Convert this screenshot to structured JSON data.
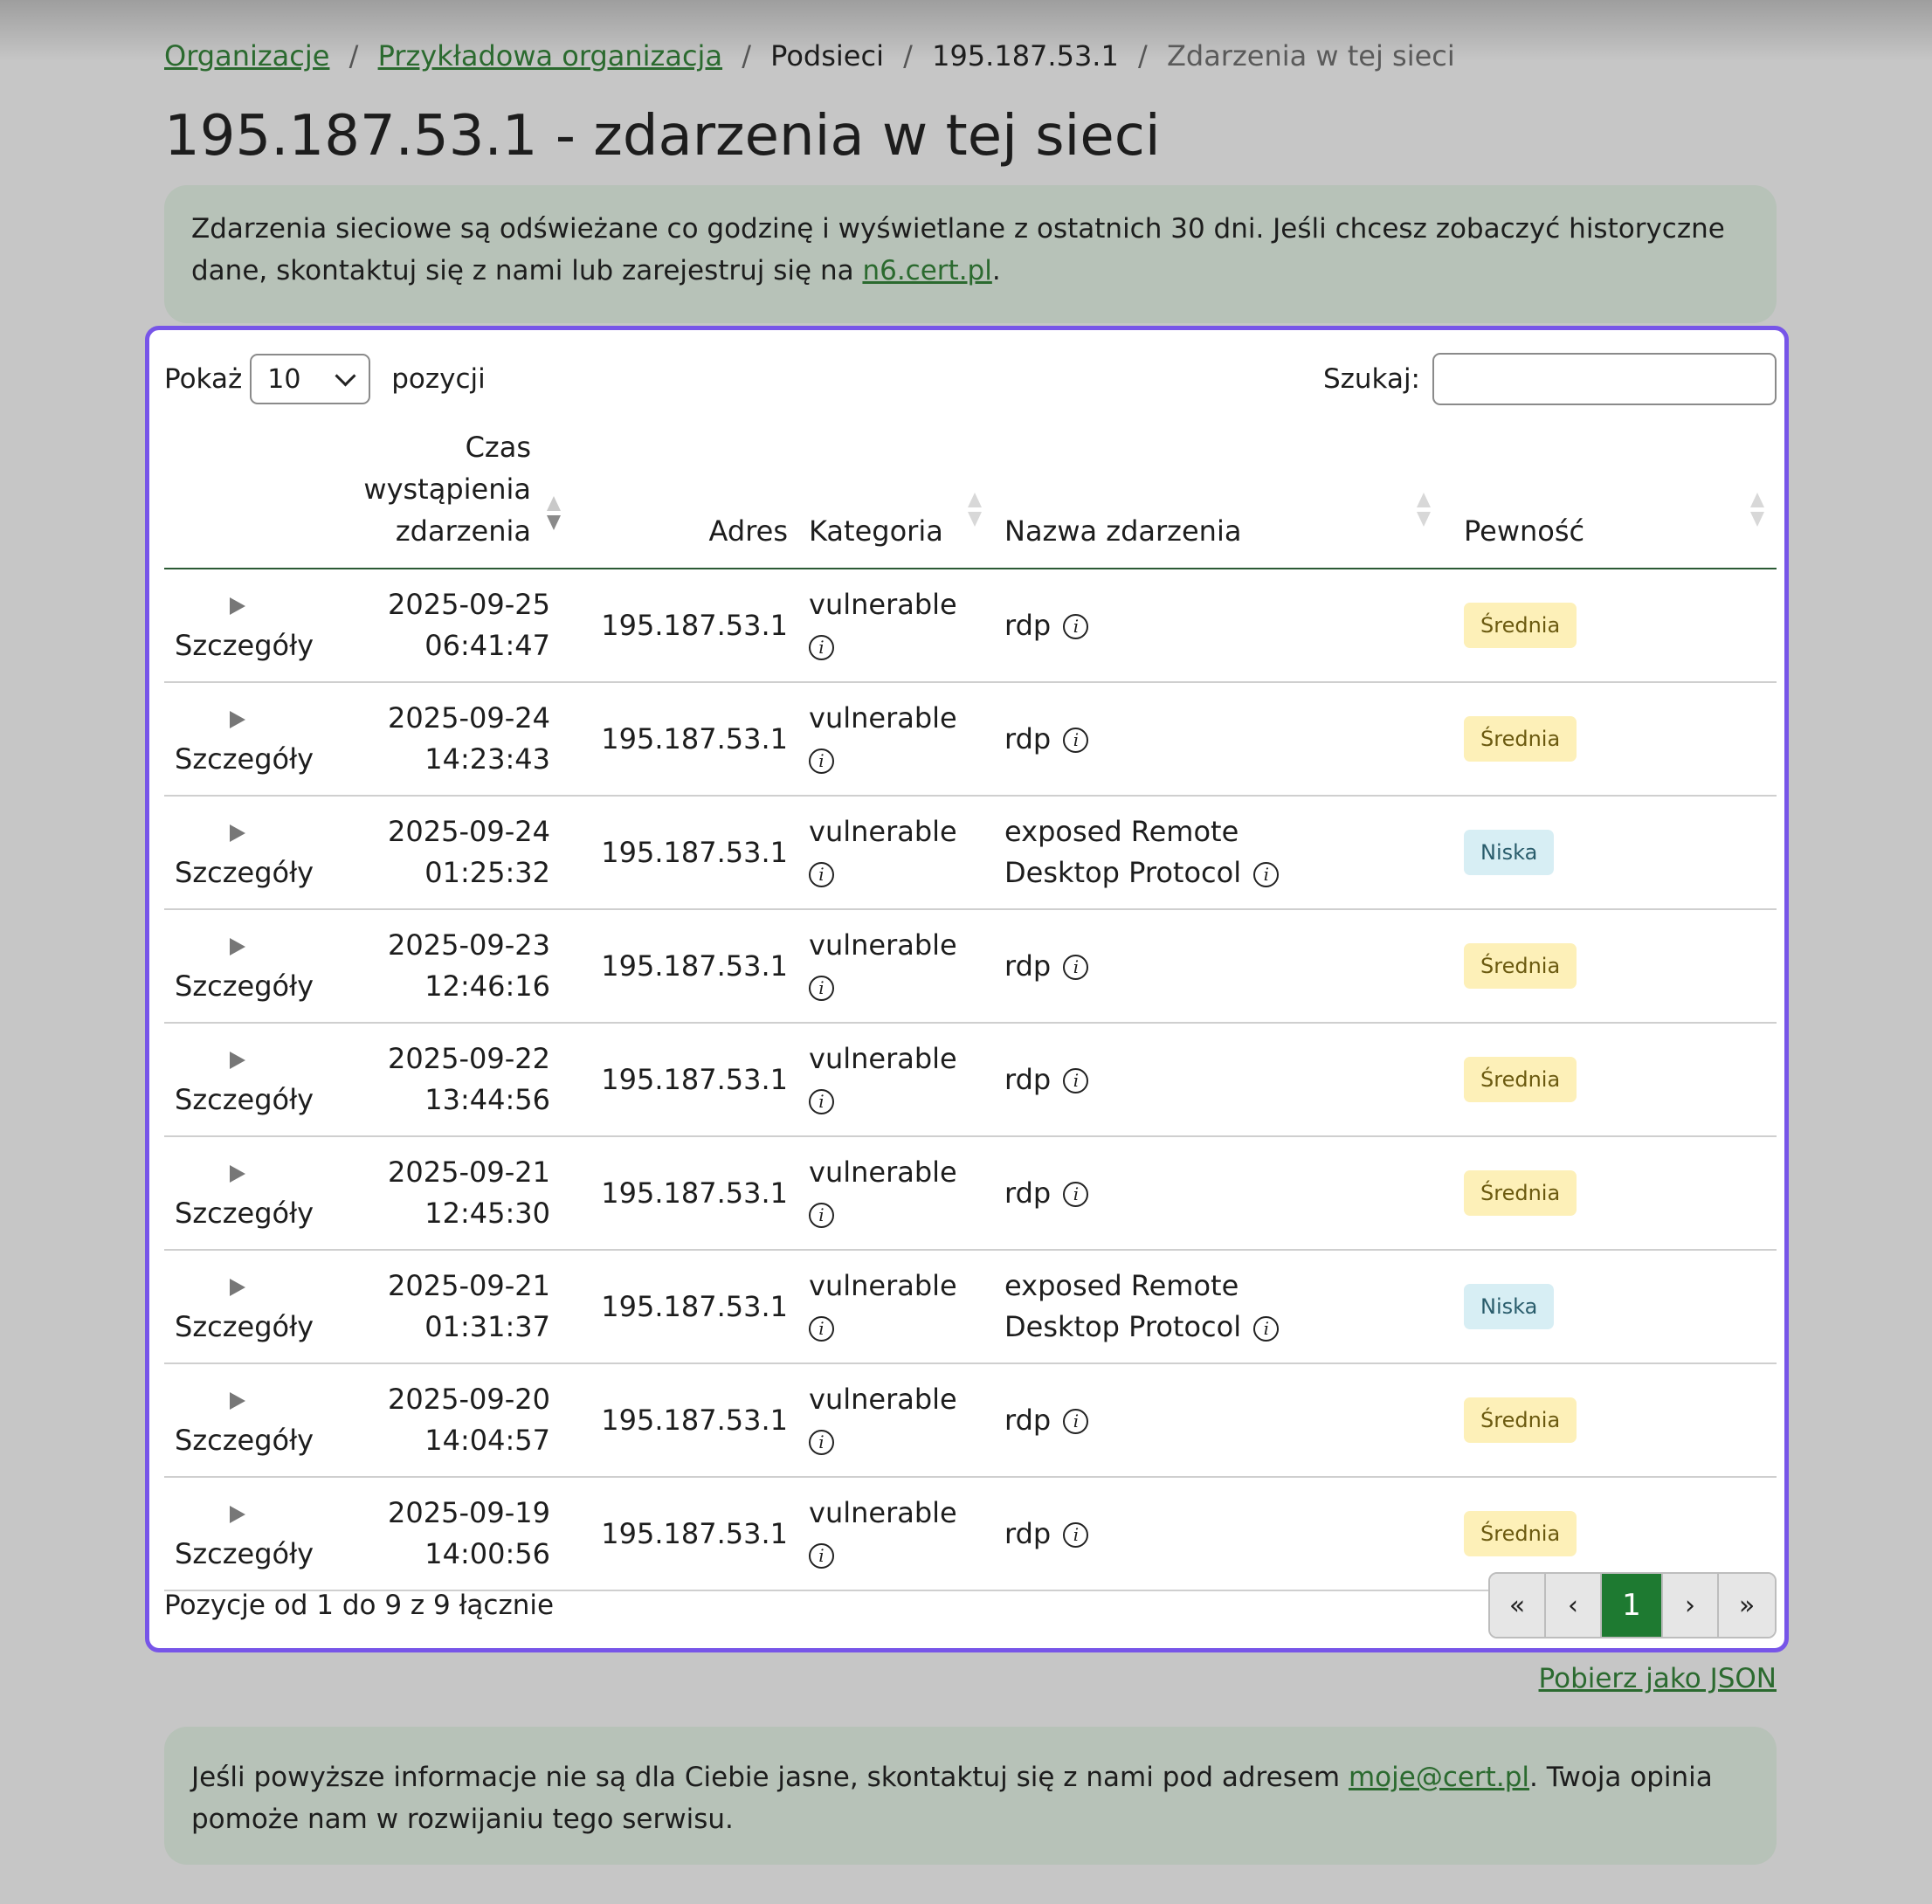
{
  "breadcrumb": {
    "organizations": "Organizacje",
    "organization": "Przykładowa organizacja",
    "subnets": "Podsieci",
    "ip": "195.187.53.1",
    "current": "Zdarzenia w tej sieci",
    "separator": "/"
  },
  "page_title": "195.187.53.1 - zdarzenia w tej sieci",
  "notice": {
    "text": "Zdarzenia sieciowe są odświeżane co godzinę i wyświetlane z ostatnich 30 dni. Jeśli chcesz zobaczyć historyczne dane, skontaktuj się z nami lub zarejestruj się na ",
    "link": "n6.cert.pl",
    "suffix": "."
  },
  "table_controls": {
    "show_label": "Pokaż",
    "page_size": "10",
    "entries_label": "pozycji",
    "search_label": "Szukaj:",
    "search_value": ""
  },
  "columns": {
    "details": "",
    "time": "Czas wystąpienia zdarzenia",
    "address": "Adres",
    "category": "Kategoria",
    "event_name": "Nazwa zdarzenia",
    "confidence": "Pewność"
  },
  "rows": [
    {
      "details": "Szczegóły",
      "time": "2025-09-25 06:41:47",
      "address": "195.187.53.1",
      "category": "vulnerable",
      "name": "rdp",
      "confidence": "Średnia",
      "level": "medium"
    },
    {
      "details": "Szczegóły",
      "time": "2025-09-24 14:23:43",
      "address": "195.187.53.1",
      "category": "vulnerable",
      "name": "rdp",
      "confidence": "Średnia",
      "level": "medium"
    },
    {
      "details": "Szczegóły",
      "time": "2025-09-24 01:25:32",
      "address": "195.187.53.1",
      "category": "vulnerable",
      "name": "exposed Remote Desktop Protocol",
      "confidence": "Niska",
      "level": "low"
    },
    {
      "details": "Szczegóły",
      "time": "2025-09-23 12:46:16",
      "address": "195.187.53.1",
      "category": "vulnerable",
      "name": "rdp",
      "confidence": "Średnia",
      "level": "medium"
    },
    {
      "details": "Szczegóły",
      "time": "2025-09-22 13:44:56",
      "address": "195.187.53.1",
      "category": "vulnerable",
      "name": "rdp",
      "confidence": "Średnia",
      "level": "medium"
    },
    {
      "details": "Szczegóły",
      "time": "2025-09-21 12:45:30",
      "address": "195.187.53.1",
      "category": "vulnerable",
      "name": "rdp",
      "confidence": "Średnia",
      "level": "medium"
    },
    {
      "details": "Szczegóły",
      "time": "2025-09-21 01:31:37",
      "address": "195.187.53.1",
      "category": "vulnerable",
      "name": "exposed Remote Desktop Protocol",
      "confidence": "Niska",
      "level": "low"
    },
    {
      "details": "Szczegóły",
      "time": "2025-09-20 14:04:57",
      "address": "195.187.53.1",
      "category": "vulnerable",
      "name": "rdp",
      "confidence": "Średnia",
      "level": "medium"
    },
    {
      "details": "Szczegóły",
      "time": "2025-09-19 14:00:56",
      "address": "195.187.53.1",
      "category": "vulnerable",
      "name": "rdp",
      "confidence": "Średnia",
      "level": "medium"
    }
  ],
  "table_info": "Pozycje od 1 do 9 z 9 łącznie",
  "pagination": {
    "first": "«",
    "prev": "‹",
    "current": "1",
    "next": "›",
    "last": "»"
  },
  "download_json": "Pobierz jako JSON",
  "contact_notice": {
    "text": "Jeśli powyższe informacje nie są dla Ciebie jasne, skontaktuj się z nami pod adresem ",
    "email": "moje@cert.pl",
    "suffix": ". Twoja opinia pomoże nam w rozwijaniu tego serwisu."
  },
  "colors": {
    "accent_link": "#2b6a2f",
    "focus_ring": "#7755e8",
    "page_active": "#1e7a31",
    "badge_medium": "#fdf0b8",
    "badge_low": "#d7eef4"
  },
  "icons": {
    "expand": "triangle-right-icon",
    "info": "info-circle-icon",
    "sort": "sort-arrows-icon"
  }
}
